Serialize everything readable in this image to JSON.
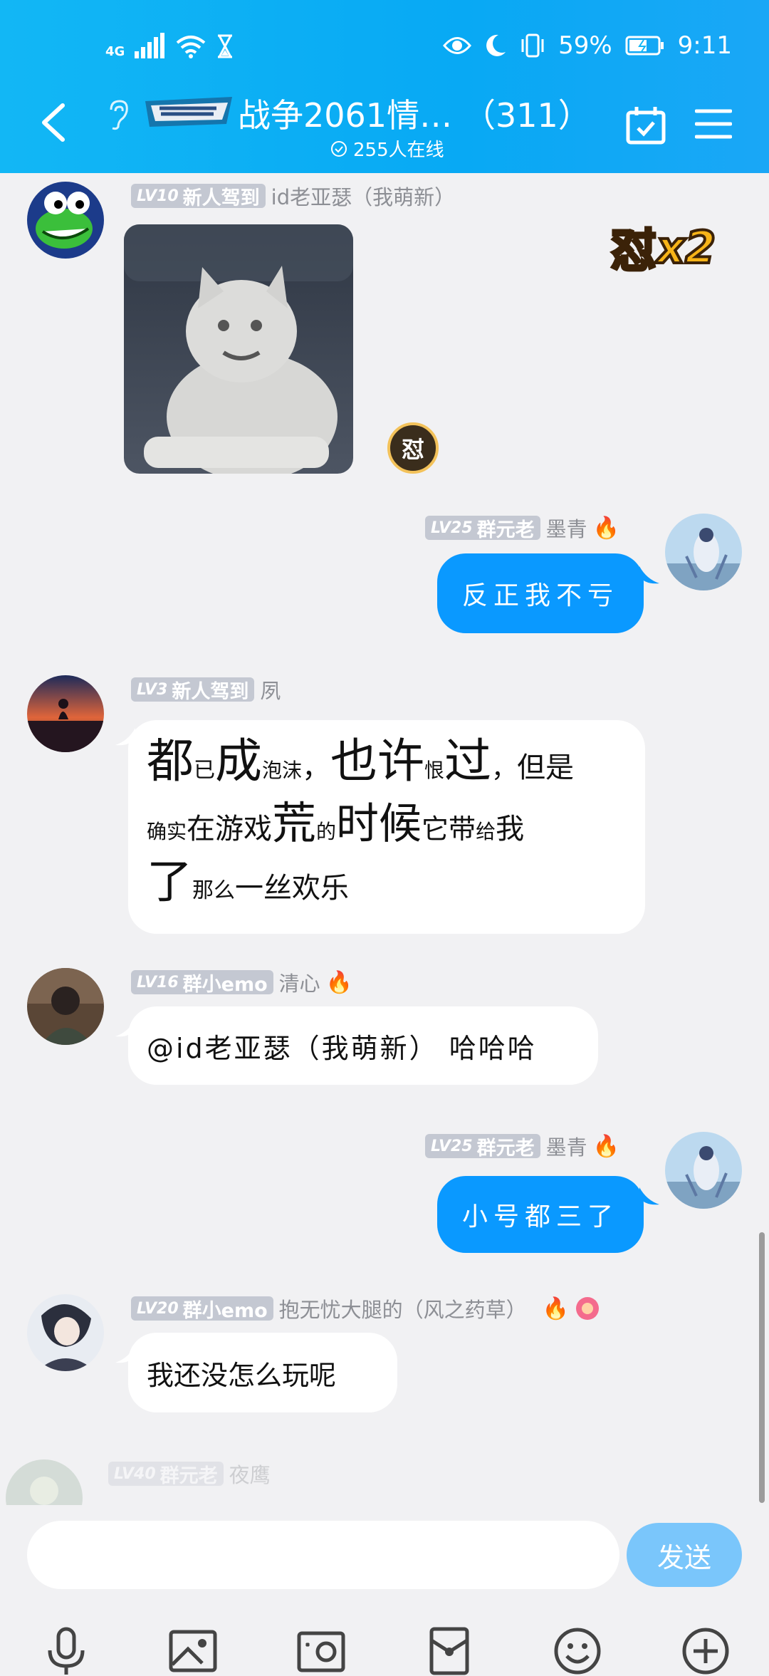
{
  "status_bar": {
    "network": "4G",
    "battery": "59%",
    "time": "9:11"
  },
  "header": {
    "group_name": "战争2061情…",
    "member_count": "（311）",
    "online": "255人在线"
  },
  "messages": [
    {
      "level": "LV10",
      "tag": "新人驾到",
      "name": "id老亚瑟（我萌新）",
      "reaction": "怼",
      "reaction_count": "x2"
    },
    {
      "level": "LV25",
      "tag": "群元老",
      "name": "墨青",
      "text": "反正我不亏"
    },
    {
      "level": "LV3",
      "tag": "新人驾到",
      "name": "夙"
    },
    {
      "level": "LV16",
      "tag": "群小emo",
      "name": "清心",
      "text": "@id老亚瑟（我萌新） 哈哈哈"
    },
    {
      "level": "LV25",
      "tag": "群元老",
      "name": "墨青",
      "text": "小号都三了"
    },
    {
      "level": "LV20",
      "tag": "群小emo",
      "name": "抱无忧大腿的（风之药草）",
      "text": "我还没怎么玩呢"
    },
    {
      "level": "LV40",
      "tag": "群元老",
      "name": "夜鹰"
    }
  ],
  "poem": {
    "w1": "都",
    "w2": "已",
    "w3": "成",
    "w4": "泡沫",
    "w5": "，",
    "w6": "也许",
    "w7": "恨",
    "w8": "过",
    "w9": "，",
    "w10": "但是",
    "w11": "确实",
    "w12": "在游戏",
    "w13": "荒",
    "w14": "的",
    "w15": "时候",
    "w16": "它带",
    "w17": "给",
    "w18": "我",
    "w19": "了",
    "w20": "那么",
    "w21": "一丝欢乐"
  },
  "input": {
    "placeholder": "",
    "send_label": "发送"
  },
  "colors": {
    "header": "#12b7f5",
    "bubble_out": "#0a99ff",
    "send": "#7ac6fb"
  },
  "icons": [
    "mic-icon",
    "image-icon",
    "camera-icon",
    "red-packet-icon",
    "emoji-icon",
    "plus-icon"
  ]
}
